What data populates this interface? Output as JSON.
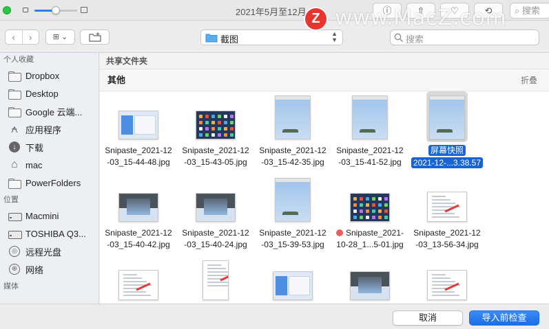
{
  "window": {
    "title": "2021年5月至12月",
    "search_placeholder": "搜索",
    "zoom_level": 0.5
  },
  "watermark": {
    "logo_letter": "Z",
    "text": "www.MacZ.com"
  },
  "toolbar": {
    "back_glyph": "‹",
    "forward_glyph": "›",
    "view_glyph": "⊞ ⌄",
    "path_label": "截图",
    "search_placeholder": "搜索"
  },
  "sidebar": {
    "favorites_header": "个人收藏",
    "favorites": [
      {
        "label": "Dropbox",
        "icon": "folder-icon"
      },
      {
        "label": "Desktop",
        "icon": "folder-icon"
      },
      {
        "label": "Google 云端...",
        "icon": "folder-icon"
      },
      {
        "label": "应用程序",
        "icon": "applications-icon"
      },
      {
        "label": "下载",
        "icon": "download-icon"
      },
      {
        "label": "mac",
        "icon": "home-icon"
      },
      {
        "label": "PowerFolders",
        "icon": "folder-icon"
      }
    ],
    "locations_header": "位置",
    "locations": [
      {
        "label": "Macmini",
        "icon": "disk-icon"
      },
      {
        "label": "TOSHIBA Q3...",
        "icon": "disk-icon"
      },
      {
        "label": "远程光盘",
        "icon": "optical-disc-icon"
      },
      {
        "label": "网络",
        "icon": "network-icon"
      }
    ],
    "media_header": "媒体"
  },
  "content": {
    "shared_header": "共享文件夹",
    "section_title": "其他",
    "collapse_label": "折叠",
    "files": [
      {
        "line1": "Snipaste_2021-12",
        "line2": "-03_15-44-48.jpg",
        "kind": "ui-blue"
      },
      {
        "line1": "Snipaste_2021-12",
        "line2": "-03_15-43-05.jpg",
        "kind": "ipad"
      },
      {
        "line1": "Snipaste_2021-12",
        "line2": "-03_15-42-35.jpg",
        "kind": "sky"
      },
      {
        "line1": "Snipaste_2021-12",
        "line2": "-03_15-41-52.jpg",
        "kind": "sky"
      },
      {
        "line1": "屏幕快照",
        "line2": "2021-12-...3.38.57",
        "kind": "sky",
        "selected": true
      },
      {
        "line1": "Snipaste_2021-12",
        "line2": "-03_15-40-42.jpg",
        "kind": "dark-top"
      },
      {
        "line1": "Snipaste_2021-12",
        "line2": "-03_15-40-24.jpg",
        "kind": "dark-top"
      },
      {
        "line1": "Snipaste_2021-12",
        "line2": "-03_15-39-53.jpg",
        "kind": "sky"
      },
      {
        "line1": "Snipaste_2021-",
        "line2": "10-28_1...5-01.jpg",
        "kind": "ipad",
        "red_tag": true
      },
      {
        "line1": "Snipaste_2021-12",
        "line2": "-03_13-56-34.jpg",
        "kind": "doc"
      },
      {
        "line1": "",
        "line2": "",
        "kind": "doc"
      },
      {
        "line1": "",
        "line2": "",
        "kind": "doc"
      },
      {
        "line1": "",
        "line2": "",
        "kind": "ui-blue"
      },
      {
        "line1": "",
        "line2": "",
        "kind": "dark-top"
      },
      {
        "line1": "",
        "line2": "",
        "kind": "doc"
      }
    ]
  },
  "footer": {
    "cancel_label": "取消",
    "import_label": "导入前检查"
  },
  "colors": {
    "accent": "#1b6ee6",
    "selection": "#1964d2",
    "red_tag": "#ec5f5a",
    "sidebar_bg": "#ecf0f4"
  }
}
